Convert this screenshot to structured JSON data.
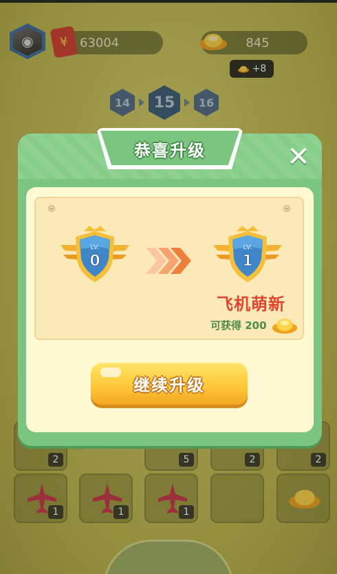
{
  "hud": {
    "cash": "63004",
    "gold": "845",
    "gold_bonus": "+8",
    "levels": {
      "prev": "14",
      "current": "15",
      "next": "16"
    }
  },
  "modal": {
    "title": "恭喜升级",
    "close_label": "✕",
    "from_badge": {
      "prefix": "LV.",
      "level": "0"
    },
    "to_badge": {
      "prefix": "LV.",
      "level": "1"
    },
    "rank_title": "飞机萌新",
    "reward_text": "可获得 200",
    "continue_label": "继续升级"
  },
  "board": {
    "counts": [
      "2",
      "5",
      "2",
      "2",
      "1",
      "1",
      "1"
    ]
  },
  "colors": {
    "modal_green": "#7cc580",
    "rank_red": "#e0452f",
    "button_yellow": "#ffc93a",
    "reward_green": "#4f8a4a"
  },
  "icons": [
    "avatar-icon",
    "cash-icon",
    "gold-ingot-icon",
    "close-icon",
    "shield-badge-icon",
    "chevron-arrows-icon",
    "plane-icon"
  ]
}
